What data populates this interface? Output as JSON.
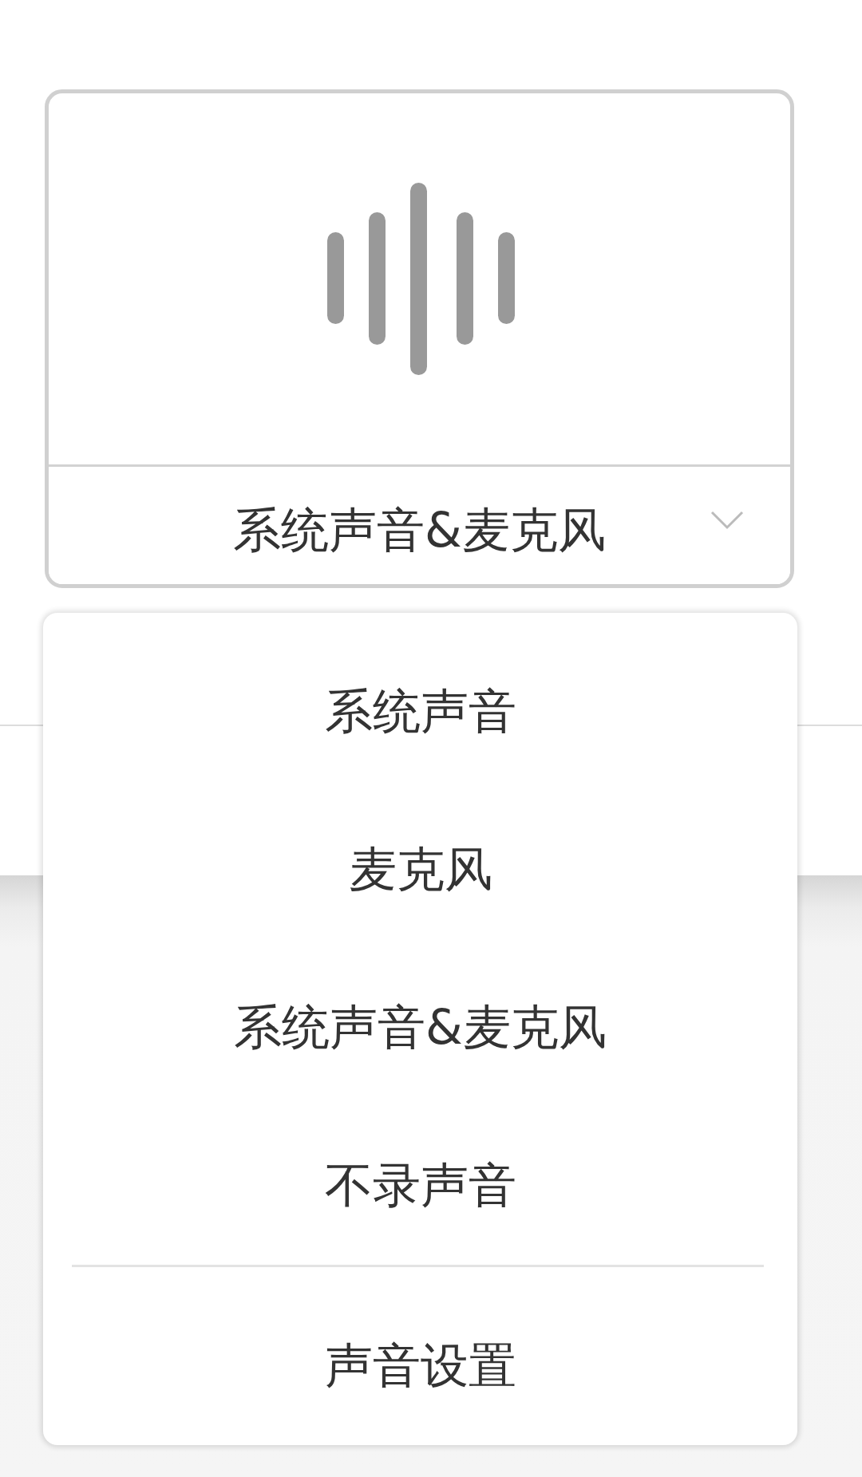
{
  "audio_source": {
    "selected_label": "系统声音&麦克风",
    "expanded": true
  },
  "menu": {
    "groups": [
      {
        "items": [
          {
            "label": "系统声音"
          },
          {
            "label": "麦克风"
          },
          {
            "label": "系统声音&麦克风"
          },
          {
            "label": "不录声音"
          }
        ]
      },
      {
        "items": [
          {
            "label": "声音设置"
          }
        ]
      }
    ]
  }
}
